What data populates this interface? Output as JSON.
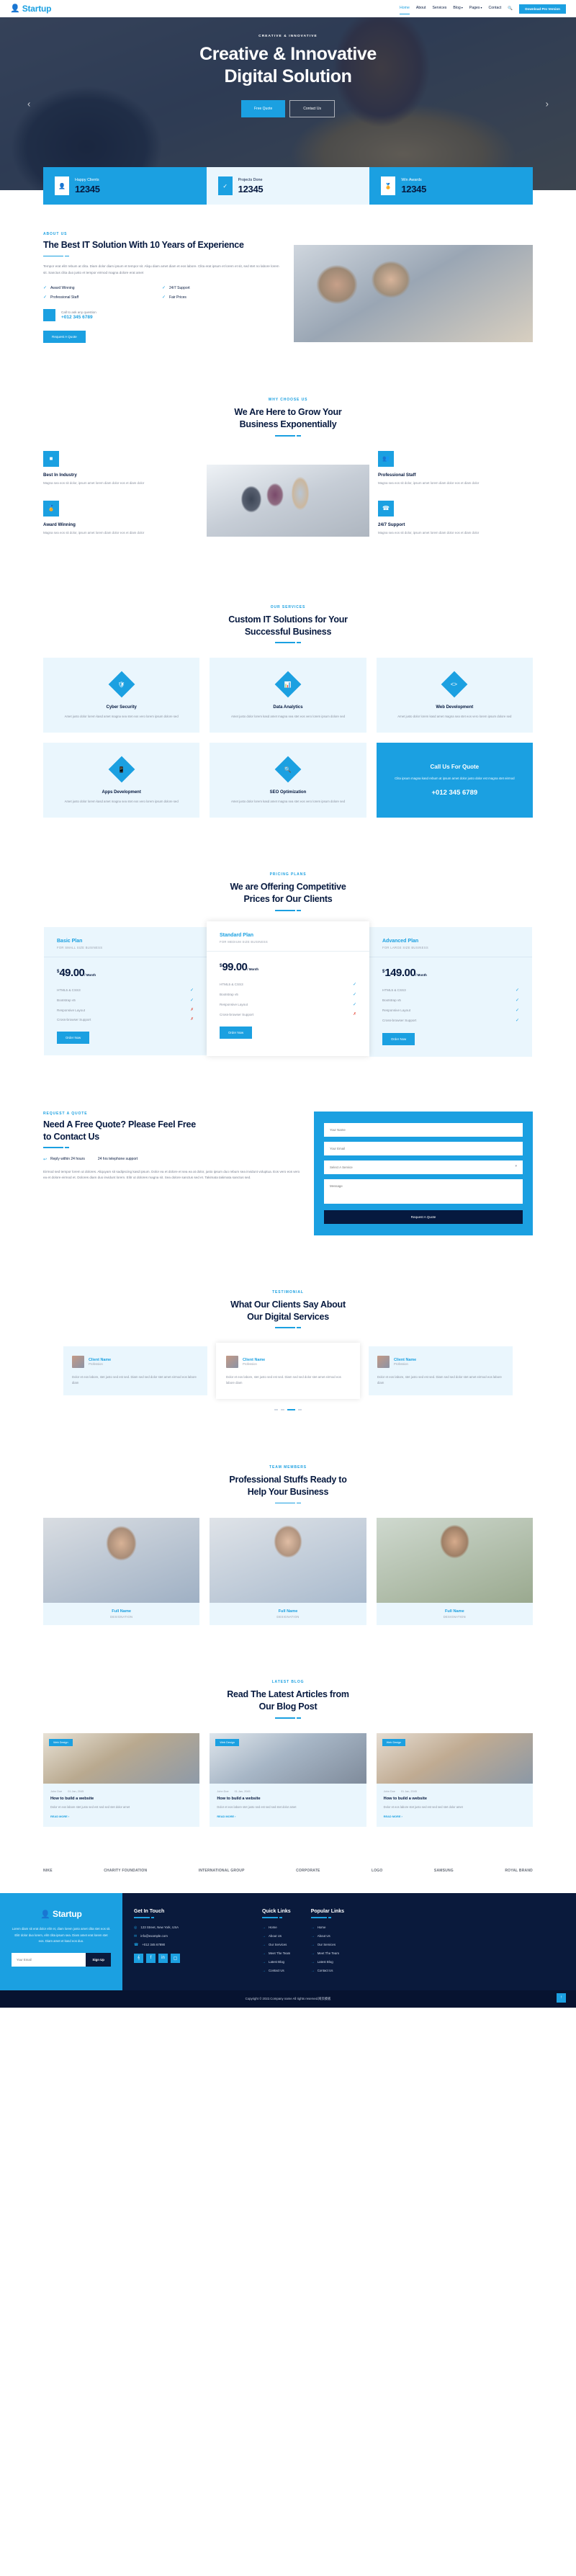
{
  "brand": {
    "name": "Startup",
    "icon": "user-tie-icon"
  },
  "nav": {
    "items": [
      {
        "label": "Home",
        "active": true
      },
      {
        "label": "About",
        "active": false
      },
      {
        "label": "Services",
        "active": false
      },
      {
        "label": "Blog",
        "caret": "▾",
        "active": false
      },
      {
        "label": "Pages",
        "caret": "▾",
        "active": false
      },
      {
        "label": "Contact",
        "active": false
      }
    ],
    "search_icon": "search-icon",
    "cta_label": "Download Pro Version"
  },
  "hero": {
    "kicker": "CREATIVE & INNOVATIVE",
    "title_line1": "Creative & Innovative",
    "title_line2": "Digital Solution",
    "btn_primary": "Free Quote",
    "btn_secondary": "Contact Us",
    "arrow_left": "‹",
    "arrow_right": "›"
  },
  "facts": [
    {
      "label": "Happy Clients",
      "value": "12345",
      "icon": "user-icon"
    },
    {
      "label": "Projects Done",
      "value": "12345",
      "icon": "check-icon"
    },
    {
      "label": "Win Awards",
      "value": "12345",
      "icon": "award-icon"
    }
  ],
  "about": {
    "kicker": "ABOUT US",
    "title": "The Best IT Solution With 10 Years of Experience",
    "paragraph": "Tempor erat elitr rebum at clita. Diam dolor diam ipsum et tempor sit. Aliqu diam amet diam et eos labore. Clita erat ipsum et lorem et sit, sed stet no labore lorem sit. Sanctus clita duo justo et tempor eirmod magna dolore erat amet",
    "features": [
      "Award Winning",
      "24/7 Support",
      "Professional Staff",
      "Fair Prices"
    ],
    "call_label": "Call to ask any question",
    "call_number": "+012 345 6789",
    "button": "Request A Quote"
  },
  "why": {
    "kicker": "WHY CHOOSE US",
    "title_line1": "We Are Here to Grow Your",
    "title_line2": "Business Exponentially",
    "items": [
      {
        "icon": "cubes-icon",
        "title": "Best In Industry",
        "text": "Magna sea eos sit dolor, ipsum amet lorem diam dolor eos et diam dolor"
      },
      {
        "icon": "award-icon",
        "title": "Award Winning",
        "text": "Magna sea eos sit dolor, ipsum amet lorem diam dolor eos et diam dolor"
      },
      {
        "icon": "users-cog-icon",
        "title": "Professional Staff",
        "text": "Magna sea eos sit dolor, ipsum amet lorem diam dolor eos et diam dolor"
      },
      {
        "icon": "phone-icon",
        "title": "24/7 Support",
        "text": "Magna sea eos sit dolor, ipsum amet lorem diam dolor eos et diam dolor"
      }
    ]
  },
  "services": {
    "kicker": "OUR SERVICES",
    "title_line1": "Custom IT Solutions for Your",
    "title_line2": "Successful Business",
    "cards": [
      {
        "icon": "shield-icon",
        "title": "Cyber Security",
        "text": "Amet justo dolor lorem kasd amet magna sea stet eos vero lorem ipsum dolore sed"
      },
      {
        "icon": "chart-icon",
        "title": "Data Analytics",
        "text": "Amet justo dolor lorem kasd amet magna sea stet eos vero lorem ipsum dolore sed"
      },
      {
        "icon": "code-icon",
        "title": "Web Development",
        "text": "Amet justo dolor lorem kasd amet magna sea stet eos vero lorem ipsum dolore sed"
      },
      {
        "icon": "mobile-icon",
        "title": "Apps Development",
        "text": "Amet justo dolor lorem kasd amet magna sea stet eos vero lorem ipsum dolore sed"
      },
      {
        "icon": "search-icon",
        "title": "SEO Optimization",
        "text": "Amet justo dolor lorem kasd amet magna sea stet eos vero lorem ipsum dolore sed"
      }
    ],
    "cta": {
      "title": "Call Us For Quote",
      "text": "Clita ipsum magna kasd rebum at ipsum amet dolor justo dolor est magna stet eirmod",
      "number": "+012 345 6789"
    }
  },
  "pricing": {
    "kicker": "PRICING PLANS",
    "title_line1": "We are Offering Competitive",
    "title_line2": "Prices for Our Clients",
    "currency": "$",
    "per": "/ Month",
    "order_label": "Order Now",
    "plans": [
      {
        "name": "Basic Plan",
        "subtitle": "FOR SMALL SIZE BUSINESS",
        "price": "49.00",
        "featured": false,
        "features": [
          {
            "label": "HTML5 & CSS3",
            "included": true
          },
          {
            "label": "Bootstrap v5",
            "included": true
          },
          {
            "label": "Responsive Layout",
            "included": false
          },
          {
            "label": "Cross-browser Support",
            "included": false
          }
        ]
      },
      {
        "name": "Standard Plan",
        "subtitle": "FOR MEDIUM SIZE BUSINESS",
        "price": "99.00",
        "featured": true,
        "features": [
          {
            "label": "HTML5 & CSS3",
            "included": true
          },
          {
            "label": "Bootstrap v5",
            "included": true
          },
          {
            "label": "Responsive Layout",
            "included": true
          },
          {
            "label": "Cross-browser Support",
            "included": false
          }
        ]
      },
      {
        "name": "Advanced Plan",
        "subtitle": "FOR LARGE SIZE BUSINESS",
        "price": "149.00",
        "featured": false,
        "features": [
          {
            "label": "HTML5 & CSS3",
            "included": true
          },
          {
            "label": "Bootstrap v5",
            "included": true
          },
          {
            "label": "Responsive Layout",
            "included": true
          },
          {
            "label": "Cross-browser Support",
            "included": true
          }
        ]
      }
    ]
  },
  "quote": {
    "kicker": "REQUEST A QUOTE",
    "title_line1": "Need A Free Quote? Please Feel Free",
    "title_line2": "to Contact Us",
    "feature1": "Reply within 24 hours",
    "feature2": "24 hrs telephone support",
    "paragraph": "Eirmod sed tempor lorem ut dolores. Aliquyam sit sadipscing kasd ipsum. Dolor ea et dolore et sea ea at dolor, justo ipsum duo rebum sea invidunt voluptua. Eos vero eos vero ea et dolore eirmod et. Dolores diam duo invidunt lorem. Elitr ut dolores magna sit. Sea dolore sanctus sed et. Takimata takimata sanctus sed.",
    "form": {
      "name_placeholder": "Your Name",
      "email_placeholder": "Your Email",
      "service_placeholder": "Select A Service",
      "message_placeholder": "Message",
      "submit_label": "Request A Quote"
    }
  },
  "testimonial": {
    "kicker": "TESTIMONIAL",
    "title_line1": "What Our Clients Say About",
    "title_line2": "Our Digital Services",
    "items": [
      {
        "name": "Client Name",
        "role": "Profession",
        "text": "Dolor et eos labore, stet justo sed est sed. Diam sed sed dolor stet amet eirmod eos labore diam"
      },
      {
        "name": "Client Name",
        "role": "Profession",
        "text": "Dolor et eos labore, stet justo sed est sed. Diam sed sed dolor stet amet eirmod eos labore diam"
      },
      {
        "name": "Client Name",
        "role": "Profession",
        "text": "Dolor et eos labore, stet justo sed est sed. Diam sed sed dolor stet amet eirmod eos labore diam"
      }
    ],
    "active_dot": 2
  },
  "team": {
    "kicker": "TEAM MEMBERS",
    "title_line1": "Professional Stuffs Ready to",
    "title_line2": "Help Your Business",
    "members": [
      {
        "name": "Full Name",
        "role": "DESIGNATION"
      },
      {
        "name": "Full Name",
        "role": "DESIGNATION"
      },
      {
        "name": "Full Name",
        "role": "DESIGNATION"
      }
    ]
  },
  "blog": {
    "kicker": "LATEST BLOG",
    "title_line1": "Read The Latest Articles from",
    "title_line2": "Our Blog Post",
    "posts": [
      {
        "tag": "Web Design",
        "author": "John Doe",
        "date": "01 Jan, 2045",
        "title": "How to build a website",
        "text": "Dolor et eos labore stet justo sed est sed sed stet dolor amet",
        "more": "READ MORE ›"
      },
      {
        "tag": "Web Design",
        "author": "John Doe",
        "date": "01 Jan, 2045",
        "title": "How to build a website",
        "text": "Dolor et eos labore stet justo sed est sed sed stet dolor amet",
        "more": "READ MORE ›"
      },
      {
        "tag": "Web Design",
        "author": "John Doe",
        "date": "01 Jan, 2045",
        "title": "How to build a website",
        "text": "Dolor et eos labore stet justo sed est sed sed stet dolor amet",
        "more": "READ MORE ›"
      }
    ]
  },
  "vendors": [
    "NIKE",
    "CHARITY FOUNDATION",
    "INTERNATIONAL GROUP",
    "CORPORATE",
    "LOGO",
    "SAMSUNG",
    "ROYAL BRAND"
  ],
  "footer": {
    "brand": "Startup",
    "brand_text": "Lorem diam sit erat dolor elitr et, diam lorem justo amet clita stet eos sit. Elitr dolor duo lorem, elitr clita ipsum sea. Diam amet erat lorem stet eos. Diam amet et kasd eos duo.",
    "email_placeholder": "Your Email",
    "signup_label": "Sign Up",
    "touch_title": "Get In Touch",
    "address": "123 Street, New York, USA",
    "email": "info@example.com",
    "phone": "+012 345 67890",
    "socials": [
      "twitter-icon",
      "facebook-icon",
      "linkedin-icon",
      "instagram-icon"
    ],
    "quick_title": "Quick Links",
    "quick_links": [
      "Home",
      "About Us",
      "Our Services",
      "Meet The Team",
      "Latest Blog",
      "Contact Us"
    ],
    "popular_title": "Popular Links",
    "popular_links": [
      "Home",
      "About Us",
      "Our Services",
      "Meet The Team",
      "Latest Blog",
      "Contact Us"
    ],
    "copyright": "Copyright © 2022.Company name All rights reserved.网页模板",
    "totop_icon": "arrow-up-icon"
  },
  "colors": {
    "accent": "#1ba0e1",
    "dark": "#06193f",
    "footer": "#0a1a3c",
    "light": "#eaf6fd"
  }
}
